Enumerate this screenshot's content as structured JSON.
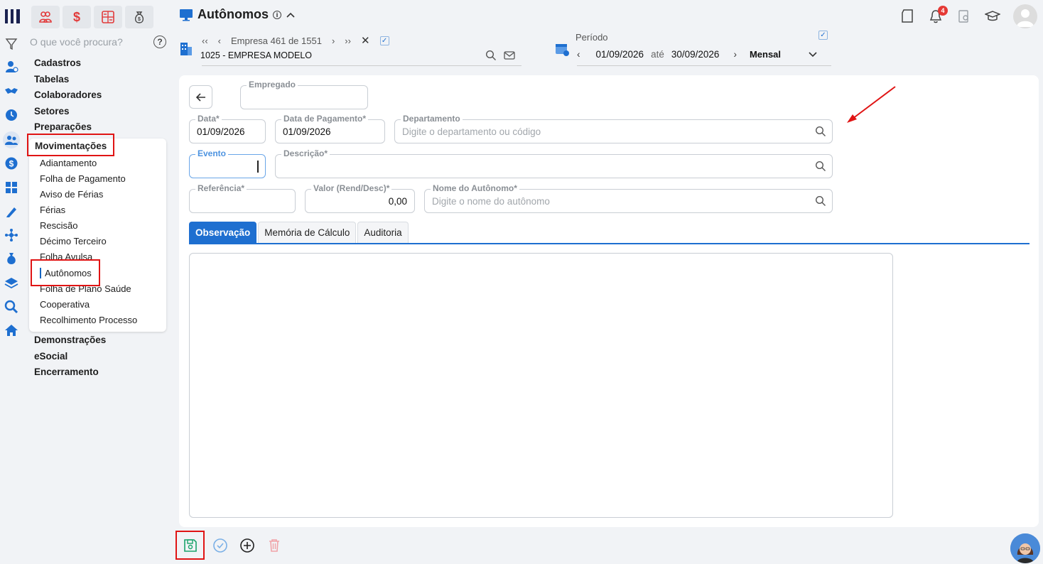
{
  "app": {
    "modules": [
      "people-group-icon",
      "dollar-icon",
      "calculator-grid-icon",
      "money-bag-icon"
    ]
  },
  "sidebar": {
    "search_placeholder": "O que você procura?",
    "top_items": [
      {
        "label": "Cadastros"
      },
      {
        "label": "Tabelas"
      },
      {
        "label": "Colaboradores"
      },
      {
        "label": "Setores"
      },
      {
        "label": "Preparações"
      }
    ],
    "expanded": {
      "label": "Movimentações",
      "items": [
        {
          "label": "Adiantamento"
        },
        {
          "label": "Folha de Pagamento"
        },
        {
          "label": "Aviso de Férias"
        },
        {
          "label": "Férias"
        },
        {
          "label": "Rescisão"
        },
        {
          "label": "Décimo Terceiro"
        },
        {
          "label": "Folha Avulsa"
        },
        {
          "label": "Autônomos"
        },
        {
          "label": "Folha de Plano Saúde"
        },
        {
          "label": "Cooperativa"
        },
        {
          "label": "Recolhimento Processo"
        }
      ]
    },
    "bottom_items": [
      {
        "label": "Demonstrações"
      },
      {
        "label": "eSocial"
      },
      {
        "label": "Encerramento"
      }
    ]
  },
  "header": {
    "title": "Autônomos",
    "company_nav": "Empresa 461 de 1551",
    "company_name": "1025 - EMPRESA MODELO",
    "period_label": "Período",
    "period_start": "01/09/2026",
    "period_sep": "até",
    "period_end": "30/09/2026",
    "period_type": "Mensal",
    "notifications_count": "4"
  },
  "form": {
    "empregado": {
      "label": "Empregado",
      "value": ""
    },
    "data": {
      "label": "Data*",
      "value": "01/09/2026"
    },
    "data_pagamento": {
      "label": "Data de Pagamento*",
      "value": "01/09/2026"
    },
    "departamento": {
      "label": "Departamento",
      "placeholder": "Digite o departamento ou código"
    },
    "evento": {
      "label": "Evento",
      "value": ""
    },
    "descricao": {
      "label": "Descrição*",
      "value": ""
    },
    "referencia": {
      "label": "Referência*",
      "value": ""
    },
    "valor": {
      "label": "Valor (Rend/Desc)*",
      "value": "0,00"
    },
    "nome_autonomo": {
      "label": "Nome do Autônomo*",
      "placeholder": "Digite o nome do autônomo"
    }
  },
  "tabs": [
    {
      "label": "Observação",
      "active": true
    },
    {
      "label": "Memória de Cálculo",
      "active": false
    },
    {
      "label": "Auditoria",
      "active": false
    }
  ],
  "colors": {
    "accent": "#1e6fd0",
    "highlight_box": "#e01414",
    "module_icon": "#e23b3b"
  }
}
